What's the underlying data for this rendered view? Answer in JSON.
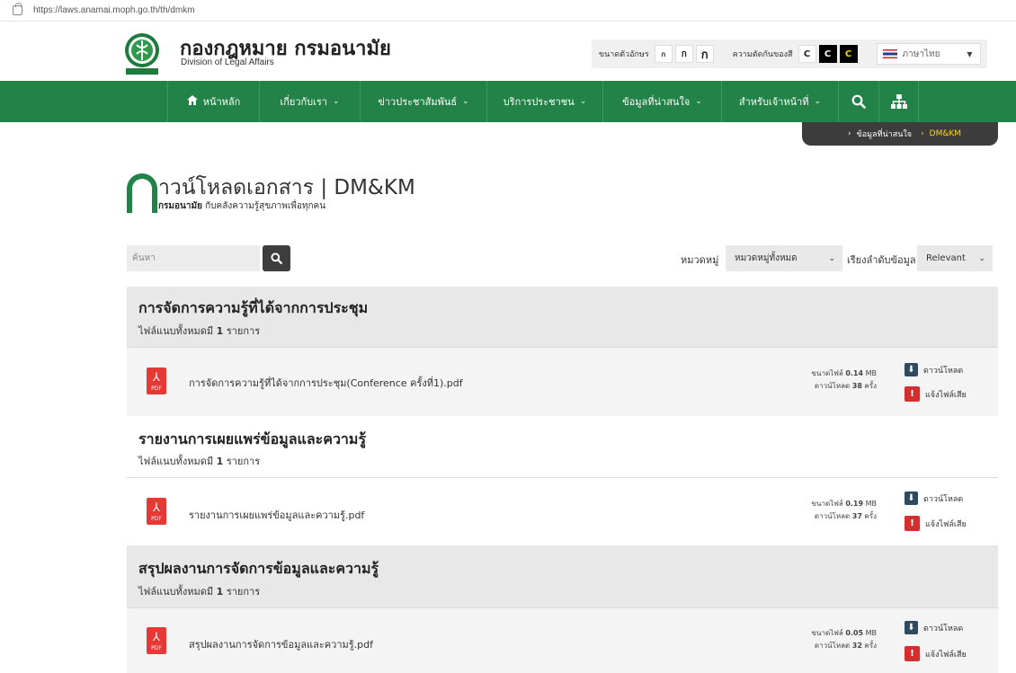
{
  "browser": {
    "url": "https://laws.anamai.moph.go.th/th/dmkm"
  },
  "header": {
    "title": "กองกฎหมาย กรมอนามัย",
    "subtitle": "Division of Legal Affairs",
    "logo_text": "กรมอนามัย",
    "font_size_label": "ขนาดตัวอักษร",
    "font_sizes": [
      "ก",
      "ก",
      "ก"
    ],
    "contrast_label": "ความตัดกันของสี",
    "contrast_options": [
      "C",
      "C",
      "C"
    ],
    "language": "ภาษาไทย"
  },
  "nav": {
    "items": [
      {
        "label": "หน้าหลัก",
        "icon": "home-icon",
        "dropdown": false
      },
      {
        "label": "เกี่ยวกับเรา",
        "dropdown": true
      },
      {
        "label": "ข่าวประชาสัมพันธ์",
        "dropdown": true
      },
      {
        "label": "บริการประชาชน",
        "dropdown": true
      },
      {
        "label": "ข้อมูลที่น่าสนใจ",
        "dropdown": true
      },
      {
        "label": "สำหรับเจ้าหน้าที่",
        "dropdown": true
      }
    ]
  },
  "breadcrumb": {
    "items": [
      "ข้อมูลที่น่าสนใจ",
      "DM&KM"
    ]
  },
  "page": {
    "title": "าวน์โหลดเอกสาร | DM&KM",
    "subtitle_bold": "กรมอนามัย",
    "subtitle_rest": " กับคลังความรู้สุขภาพเพื่อทุกคน"
  },
  "filters": {
    "search_placeholder": "ค้นหา",
    "category_label": "หมวดหมู่",
    "category_value": "หมวดหมู่ทั้งหมด",
    "sort_label": "เรียงลำดับข้อมูล",
    "sort_value": "Relevant"
  },
  "sections": [
    {
      "title": "การจัดการความรู้ที่ได้จากการประชุม",
      "count_prefix": "ไฟล์แนบทั้งหมดมี ",
      "count": "1",
      "count_suffix": " รายการ",
      "file": {
        "name": "การจัดการความรู้ที่ได้จากการประชุม(Conference ครั้งที่1).pdf",
        "size_label": "ขนาดไฟล์ ",
        "size": "0.14",
        "size_unit": " MB",
        "dl_label": "ดาวน์โหลด ",
        "downloads": "38",
        "dl_unit": " ครั้ง"
      }
    },
    {
      "title": "รายงานการเผยแพร่ข้อมูลและความรู้",
      "count_prefix": "ไฟล์แนบทั้งหมดมี ",
      "count": "1",
      "count_suffix": " รายการ",
      "file": {
        "name": "รายงานการเผยแพร่ข้อมูลและความรู้.pdf",
        "size_label": "ขนาดไฟล์ ",
        "size": "0.19",
        "size_unit": " MB",
        "dl_label": "ดาวน์โหลด ",
        "downloads": "37",
        "dl_unit": " ครั้ง"
      }
    },
    {
      "title": "สรุปผลงานการจัดการข้อมูลและความรู้",
      "count_prefix": "ไฟล์แนบทั้งหมดมี ",
      "count": "1",
      "count_suffix": " รายการ",
      "file": {
        "name": "สรุปผลงานการจัดการข้อมูลและความรู้.pdf",
        "size_label": "ขนาดไฟล์ ",
        "size": "0.05",
        "size_unit": " MB",
        "dl_label": "ดาวน์โหลด ",
        "downloads": "32",
        "dl_unit": " ครั้ง"
      }
    }
  ],
  "actions": {
    "download": "ดาวน์โหลด",
    "report": "แจ้งไฟล์เสีย"
  },
  "pdf_label": "PDF",
  "colors": {
    "primary_green": "#228247",
    "pdf_red": "#e53935",
    "breadcrumb_active": "#ffd800"
  }
}
